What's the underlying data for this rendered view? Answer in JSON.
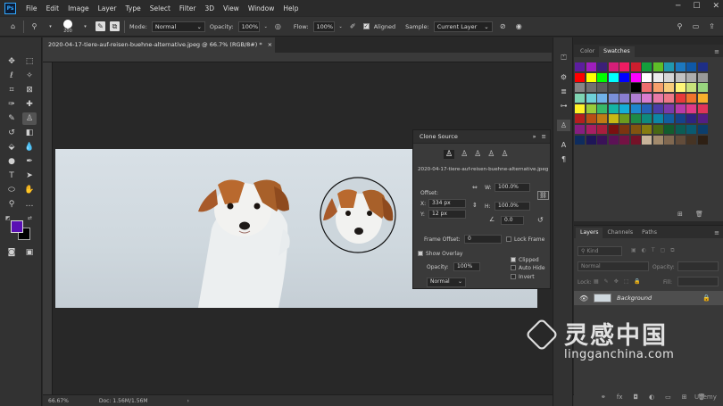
{
  "menu": {
    "logo": "Ps",
    "items": [
      "File",
      "Edit",
      "Image",
      "Layer",
      "Type",
      "Select",
      "Filter",
      "3D",
      "View",
      "Window",
      "Help"
    ]
  },
  "options": {
    "brush_size": "200",
    "mode_label": "Mode:",
    "mode_value": "Normal",
    "opacity_label": "Opacity:",
    "opacity_value": "100%",
    "flow_label": "Flow:",
    "flow_value": "100%",
    "aligned_label": "Aligned",
    "sample_label": "Sample:",
    "sample_value": "Current Layer"
  },
  "document": {
    "tab_title": "2020-04-17-tiere-auf-reisen-buehne-alternative.jpeg @ 66.7% (RGB/8#) *",
    "zoom": "66.67%",
    "doc_info": "Doc: 1.56M/1.56M"
  },
  "clone_source": {
    "title": "Clone Source",
    "filename": "2020-04-17-tiere-auf-reisen-buehne-alternative.jpeg",
    "offset_label": "Offset:",
    "x_label": "X:",
    "x_value": "334 px",
    "y_label": "Y:",
    "y_value": "12 px",
    "w_label": "W:",
    "w_value": "100.0%",
    "h_label": "H:",
    "h_value": "100.0%",
    "angle_value": "0.0",
    "frame_offset_label": "Frame Offset:",
    "frame_offset_value": "0",
    "lock_frame_label": "Lock Frame",
    "show_overlay_label": "Show Overlay",
    "overlay_opacity_label": "Opacity:",
    "overlay_opacity_value": "100%",
    "clipped_label": "Clipped",
    "auto_hide_label": "Auto Hide",
    "invert_label": "Invert",
    "blend_value": "Normal"
  },
  "swatches": {
    "tabs": [
      "Color",
      "Swatches"
    ],
    "colors": [
      "#5c1e9e",
      "#a01ebe",
      "#3c2078",
      "#d41e78",
      "#ee1c62",
      "#cc1e2e",
      "#149e3c",
      "#5ebe28",
      "#2098b0",
      "#1c78c0",
      "#0e58a8",
      "#1e2e86",
      "#ff0000",
      "#ffff00",
      "#00ff00",
      "#00ffff",
      "#0000ff",
      "#ff00ff",
      "#ffffff",
      "#ebebeb",
      "#d6d6d6",
      "#c2c2c2",
      "#adadad",
      "#999999",
      "#858585",
      "#707070",
      "#5c5c5c",
      "#474747",
      "#333333",
      "#000000",
      "#ee6e6e",
      "#f6a06c",
      "#f8cc7a",
      "#fff678",
      "#c8e27a",
      "#98d47e",
      "#7ed4b2",
      "#6ed0d8",
      "#70b2e8",
      "#7a90d8",
      "#8a7ed0",
      "#b07ed2",
      "#d97cd0",
      "#e87aa8",
      "#ee7888",
      "#e83a3a",
      "#f0742c",
      "#f6b02c",
      "#fff226",
      "#98cc3a",
      "#38b868",
      "#14b4a4",
      "#14aed8",
      "#1e86cc",
      "#2660b8",
      "#4a3ea8",
      "#7a3aaa",
      "#b83aa8",
      "#e03a88",
      "#e0345a",
      "#b41e1e",
      "#b84e14",
      "#c07c14",
      "#c8b814",
      "#6c9a1e",
      "#1e8a46",
      "#0e8a7e",
      "#0c86a6",
      "#125ea0",
      "#16428a",
      "#2e2480",
      "#541e84",
      "#861e80",
      "#a81e64",
      "#a81e3e",
      "#7a1010",
      "#7c3410",
      "#825410",
      "#867c10",
      "#486814",
      "#125c2e",
      "#0c5c54",
      "#0a5a70",
      "#0c3e6c",
      "#0e2c5e",
      "#1e1658",
      "#3a1258",
      "#5c1256",
      "#741244",
      "#741228",
      "#c8b49a",
      "#a28a6c",
      "#806850",
      "#624c3a",
      "#463424",
      "#2e2014"
    ]
  },
  "layers": {
    "tabs": [
      "Layers",
      "Channels",
      "Paths"
    ],
    "kind_label": "Kind",
    "blend_value": "Normal",
    "opacity_label": "Opacity:",
    "lock_label": "Lock:",
    "fill_label": "Fill:",
    "layer_name": "Background"
  },
  "watermark": {
    "cn_text": "灵感中国",
    "url_text": "lingganchina.com",
    "udemy": "Udemy"
  }
}
